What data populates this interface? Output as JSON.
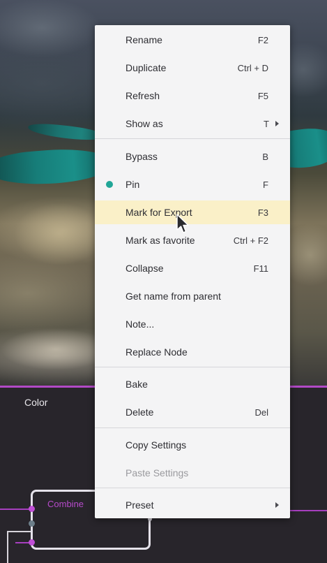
{
  "colors": {
    "menu_bg": "#f4f4f5",
    "hover_bg": "#faf0c8",
    "pin_dot": "#21a697",
    "accent_magenta": "#b24ac6",
    "graph_bg": "#28252b"
  },
  "graph": {
    "panel_title": "Color",
    "node_label": "Combine"
  },
  "menu": {
    "rename": {
      "label": "Rename",
      "shortcut": "F2"
    },
    "duplicate": {
      "label": "Duplicate",
      "shortcut": "Ctrl + D"
    },
    "refresh": {
      "label": "Refresh",
      "shortcut": "F5"
    },
    "show_as": {
      "label": "Show as",
      "shortcut": "T",
      "icon": "chevron-right-icon"
    },
    "bypass": {
      "label": "Bypass",
      "shortcut": "B"
    },
    "pin": {
      "label": "Pin",
      "shortcut": "F",
      "active": true
    },
    "mark_for_export": {
      "label": "Mark for Export",
      "shortcut": "F3",
      "hovered": true
    },
    "mark_as_favorite": {
      "label": "Mark as favorite",
      "shortcut": "Ctrl + F2"
    },
    "collapse": {
      "label": "Collapse",
      "shortcut": "F11"
    },
    "get_name_from_parent": {
      "label": "Get name from parent"
    },
    "note": {
      "label": "Note..."
    },
    "replace_node": {
      "label": "Replace Node"
    },
    "bake": {
      "label": "Bake"
    },
    "delete": {
      "label": "Delete",
      "shortcut": "Del"
    },
    "copy_settings": {
      "label": "Copy Settings"
    },
    "paste_settings": {
      "label": "Paste Settings",
      "disabled": true
    },
    "preset": {
      "label": "Preset",
      "icon": "chevron-right-icon"
    }
  }
}
